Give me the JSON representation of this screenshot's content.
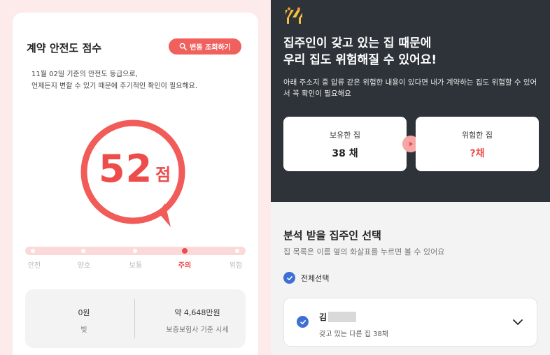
{
  "left": {
    "title": "계약 안전도 점수",
    "history_button": "변동 조회하기",
    "description_line1": "11월 02일 기준의 안전도 등급으로,",
    "description_line2": "언제든지 변할 수 있기 때문에 주기적인 확인이 필요해요.",
    "score": "52",
    "score_unit": "점",
    "levels": [
      "안전",
      "양호",
      "보통",
      "주의",
      "위험"
    ],
    "active_level": "주의",
    "summary": {
      "debt_value": "0원",
      "debt_label": "빚",
      "market_value": "약 4,648만원",
      "market_label": "보증보험사 기준 시세"
    },
    "colors": {
      "accent": "#ee4b4b",
      "button": "#f0605d"
    }
  },
  "right": {
    "headline_line1": "집주인이 갖고 있는 집 때문에",
    "headline_line2": "우리 집도 위험해질 수 있어요!",
    "subtext": "아래 주소지 중 압류 같은 위험한 내용이 있다면 내가 계약하는 집도 위험할 수 있어서 꼭 확인이 필요해요",
    "owned": {
      "label": "보유한 집",
      "value": "38 채"
    },
    "risky": {
      "label": "위험한 집",
      "value": "?채"
    },
    "section_title": "분석 받을 집주인 선택",
    "section_sub": "집 목록은 이름 옆의 화살표를 누르면 볼 수 있어요",
    "select_all": "전체선택",
    "owner": {
      "name": "김",
      "houses": "갖고 있는 다른 집 38채"
    },
    "colors": {
      "dark_bg": "#2d3339",
      "check": "#3d6fd6"
    }
  }
}
